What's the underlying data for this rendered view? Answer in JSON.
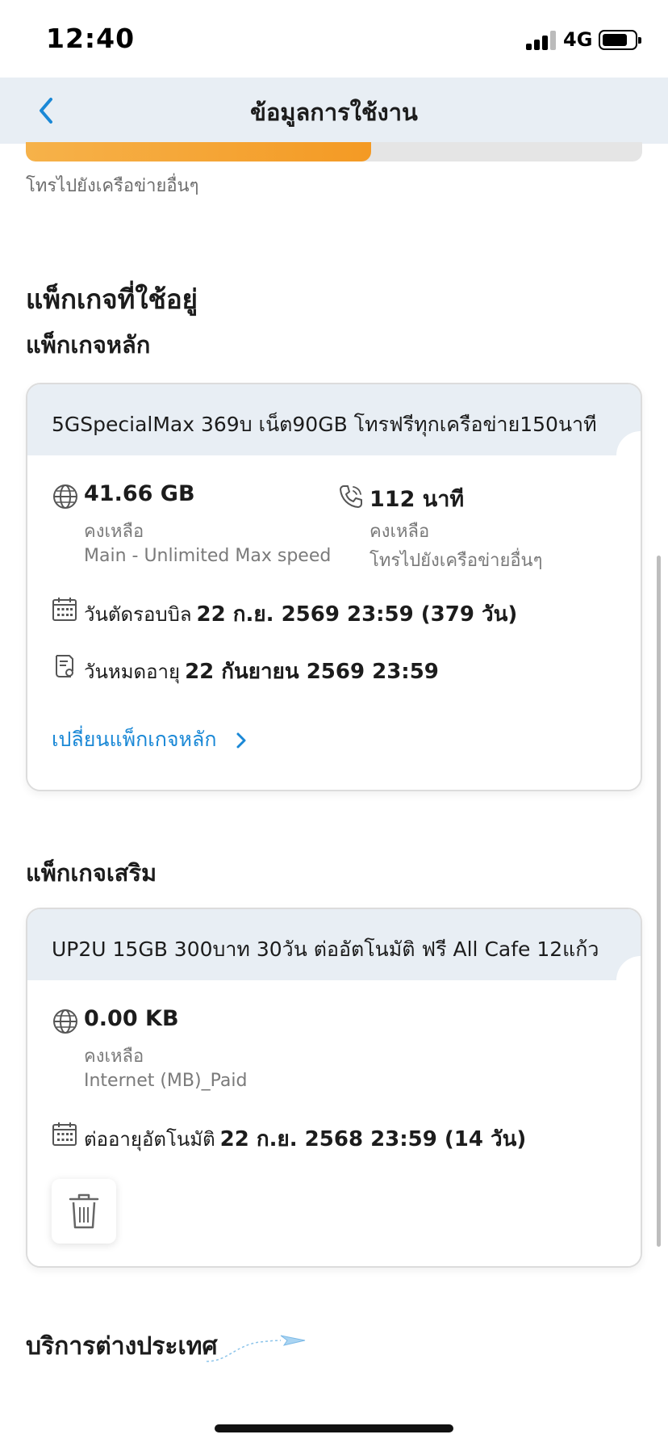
{
  "status_bar": {
    "time": "12:40",
    "network": "4G"
  },
  "header": {
    "title": "ข้อมูลการใช้งาน",
    "back_icon": "chevron-left-icon"
  },
  "usage": {
    "caption": "โทรไปยังเครือข่ายอื่นๆ",
    "progress_fraction": 0.56
  },
  "packages": {
    "section_title": "แพ็กเกจที่ใช้อยู่",
    "main_title": "แพ็กเกจหลัก",
    "main_card": {
      "name": "5GSpecialMax 369บ เน็ต90GB โทรฟรีทุกเครือข่าย150นาที",
      "data": {
        "icon": "globe-icon",
        "amount": "41.66 GB",
        "remain": "คงเหลือ",
        "desc": "Main - Unlimited Max speed"
      },
      "voice": {
        "icon": "phone-icon",
        "amount": "112 นาที",
        "remain": "คงเหลือ",
        "desc": "โทรไปยังเครือข่ายอื่นๆ"
      },
      "billing": {
        "icon": "calendar-icon",
        "label": "วันตัดรอบบิล",
        "value": "22 ก.ย. 2569 23:59 (379 วัน)"
      },
      "expiry": {
        "icon": "document-icon",
        "label": "วันหมดอายุ",
        "value": "22 กันยายน 2569 23:59"
      },
      "change_link": "เปลี่ยนแพ็กเกจหลัก"
    },
    "extra_title": "แพ็กเกจเสริม",
    "extra_card": {
      "name": "UP2U 15GB 300บาท 30วัน ต่ออัตโนมัติ ฟรี All Cafe 12แก้ว",
      "data": {
        "icon": "globe-icon",
        "amount": "0.00 KB",
        "remain": "คงเหลือ",
        "desc": "Internet (MB)_Paid"
      },
      "renew": {
        "icon": "calendar-icon",
        "label": "ต่ออายุอัตโนมัติ",
        "value": "22 ก.ย. 2568 23:59 (14 วัน)"
      },
      "delete_icon": "trash-icon"
    }
  },
  "international": {
    "title": "บริการต่างประเทศ",
    "icon": "paper-plane-icon"
  },
  "colors": {
    "accent_orange": "#f49a24",
    "link_blue": "#1a88d6",
    "header_bg": "#e8eef4"
  }
}
